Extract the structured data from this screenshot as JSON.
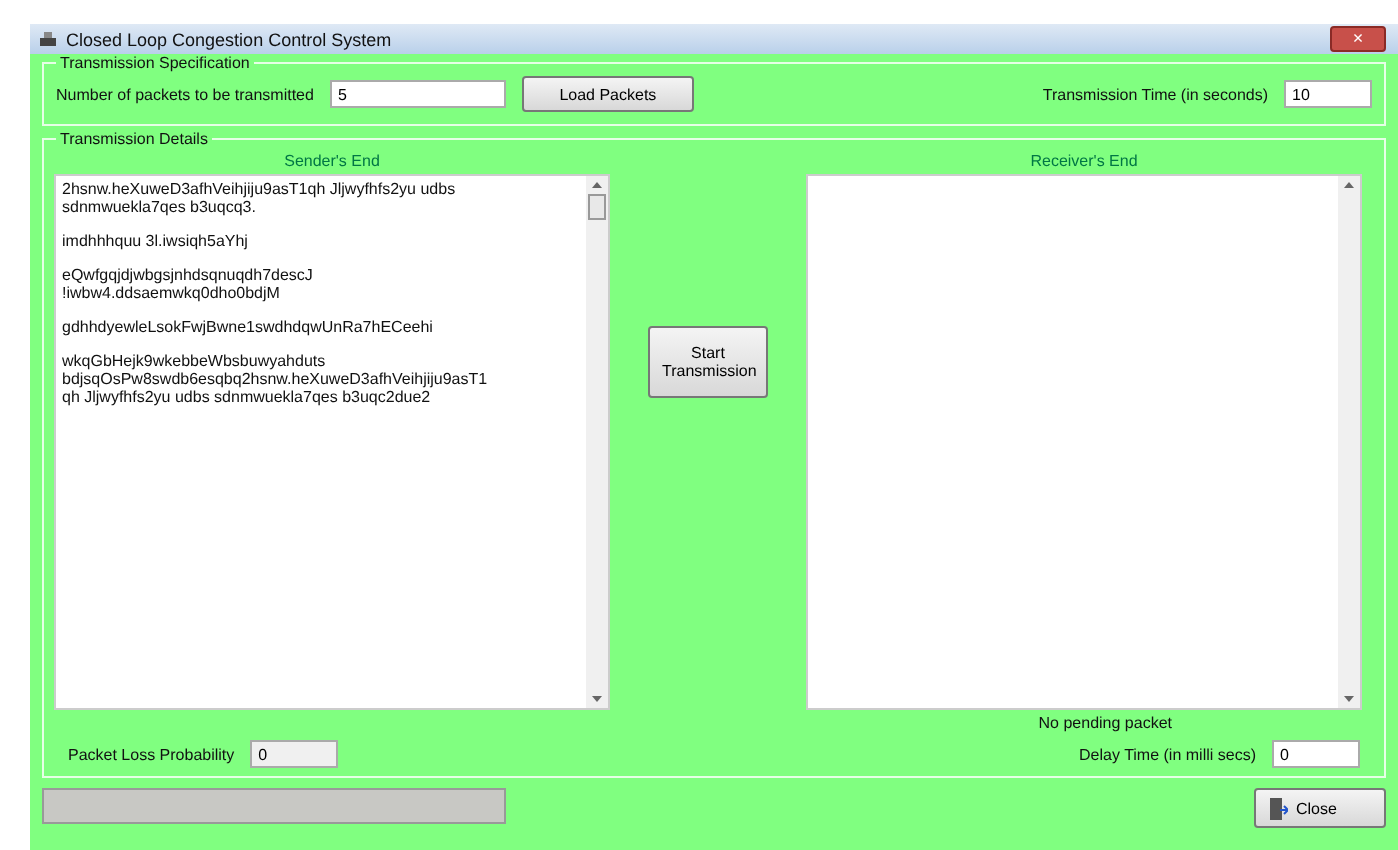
{
  "window": {
    "title": "Closed Loop Congestion Control System",
    "close": "×"
  },
  "specification": {
    "title": "Transmission Specification",
    "packets_label": "Number of packets to be transmitted",
    "packets_value": "5",
    "load_button": "Load Packets",
    "time_label": "Transmission Time (in seconds)",
    "time_value": "10"
  },
  "details": {
    "title": "Transmission Details",
    "sender": {
      "title": "Sender's End",
      "paragraphs": [
        [
          "2hsnw.heXuweD3afhVeihjiju9asT1qh Jljwyfhfs2yu udbs",
          "sdnmwuekla7qes b3uqcq3."
        ],
        [
          "imdhhhquu 3l.iwsiqh5aYhj"
        ],
        [
          "eQwfgqjdjwbgsjnhdsqnuqdh7descJ",
          "!iwbw4.ddsaemwkq0dho0bdjM"
        ],
        [
          "gdhhdyewleLsokFwjBwne1swdhdqwUnRa7hECeehi"
        ],
        [
          "wkqGbHejk9wkebbeWbsbuwyahduts",
          "bdjsqOsPw8swdb6esqbq2hsnw.heXuweD3afhVeihjiju9asT1",
          "qh Jljwyfhfs2yu udbs sdnmwuekla7qes b3uqc2due2"
        ]
      ]
    },
    "start_button": "Start Transmission",
    "receiver": {
      "title": "Receiver's End"
    },
    "status": "No pending packet",
    "loss_label": "Packet Loss Probability",
    "loss_value": "0",
    "delay_label": "Delay Time (in milli secs)",
    "delay_value": "0"
  },
  "close_button": "Close"
}
